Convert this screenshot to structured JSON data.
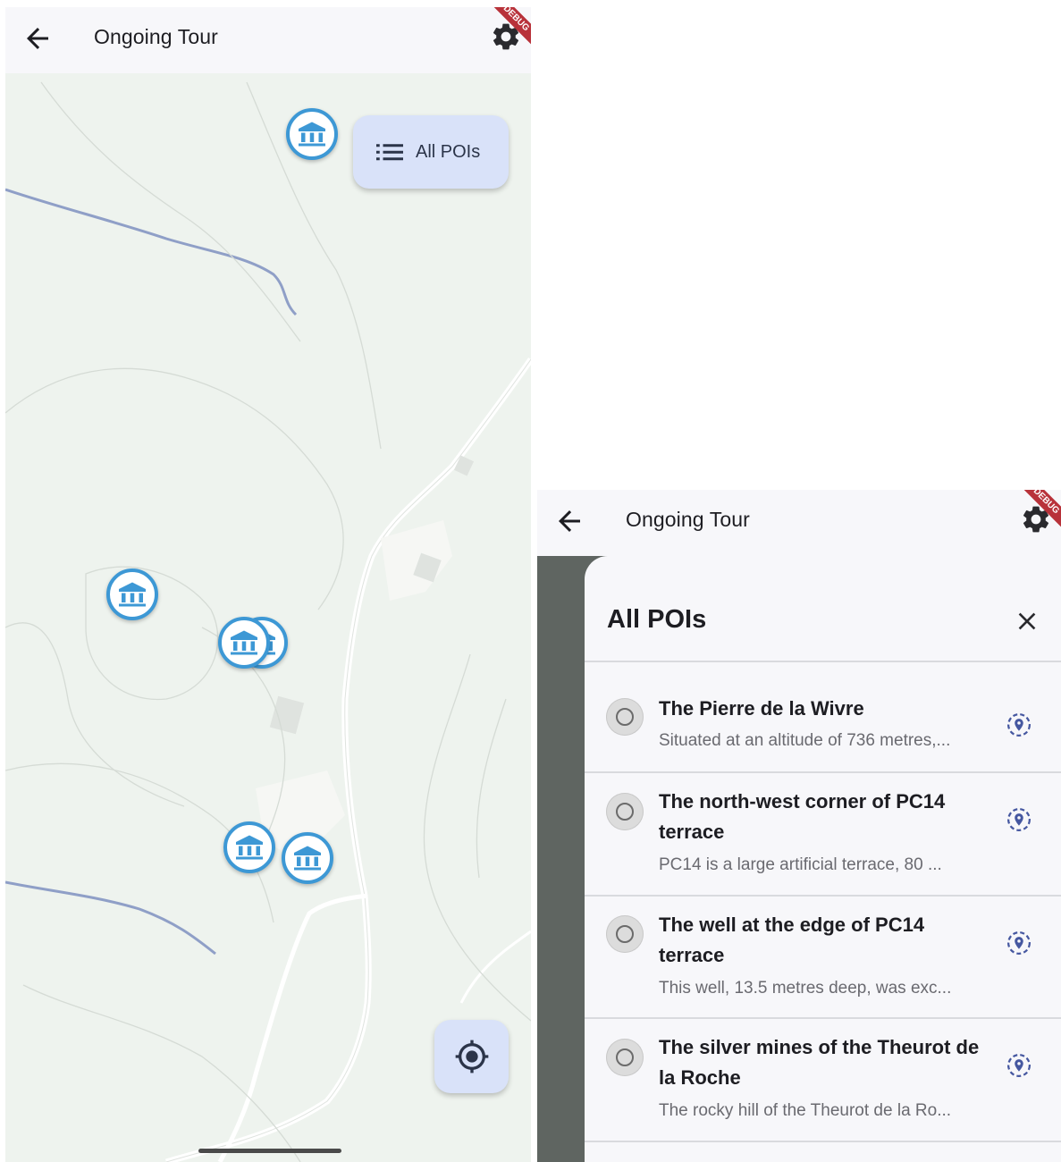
{
  "left_screen": {
    "appbar": {
      "title": "Ongoing Tour",
      "debug_label": "DEBUG"
    },
    "map": {
      "poi_icon": "museum-icon",
      "fab_all_pois": {
        "label": "All POIs",
        "icon": "list-icon"
      },
      "fab_locate": {
        "icon": "my-location-icon"
      }
    }
  },
  "right_screen": {
    "appbar": {
      "title": "Ongoing Tour",
      "debug_label": "DEBUG"
    },
    "panel": {
      "title": "All POIs",
      "close_icon": "close-icon",
      "items": [
        {
          "name": "The Pierre de la Wivre",
          "description": "Situated at an altitude of 736 metres,..."
        },
        {
          "name": "The north-west corner of PC14 terrace",
          "description": "PC14 is a large artificial terrace, 80 ..."
        },
        {
          "name": "The well at the edge of PC14 terrace",
          "description": "This well, 13.5 metres deep, was exc..."
        },
        {
          "name": "The silver mines of the Theurot de la Roche",
          "description": "The rocky hill of the Theurot de la Ro..."
        }
      ]
    }
  },
  "colors": {
    "map_background": "#eef3ee",
    "poi_border": "#3d98d5",
    "fab_background": "#d9e2f9",
    "appbar_background": "#f7f7fa",
    "debug_banner": "#b8323a",
    "locate_icon": "#4557a0"
  }
}
